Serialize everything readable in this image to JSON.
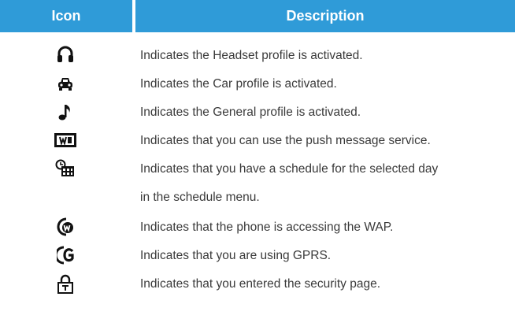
{
  "header": {
    "icon_label": "Icon",
    "description_label": "Description"
  },
  "colors": {
    "header_bg": "#2f9bd8",
    "header_text": "#ffffff",
    "body_text": "#3a3a3a"
  },
  "rows": [
    {
      "icon": "headset-icon",
      "text": "Indicates the Headset profile is activated."
    },
    {
      "icon": "car-icon",
      "text": "Indicates the Car profile is activated."
    },
    {
      "icon": "music-note-icon",
      "text": "Indicates the General profile is activated."
    },
    {
      "icon": "push-message-icon",
      "text": "Indicates that you can use the push message service."
    },
    {
      "icon": "schedule-icon",
      "text": "Indicates that you have a schedule for the selected day",
      "text2": "in the schedule menu."
    },
    {
      "icon": "wap-icon",
      "text": "Indicates that the phone is accessing the WAP."
    },
    {
      "icon": "gprs-icon",
      "text": "Indicates that you are using GPRS."
    },
    {
      "icon": "security-icon",
      "text": "Indicates that you entered the security page."
    }
  ]
}
